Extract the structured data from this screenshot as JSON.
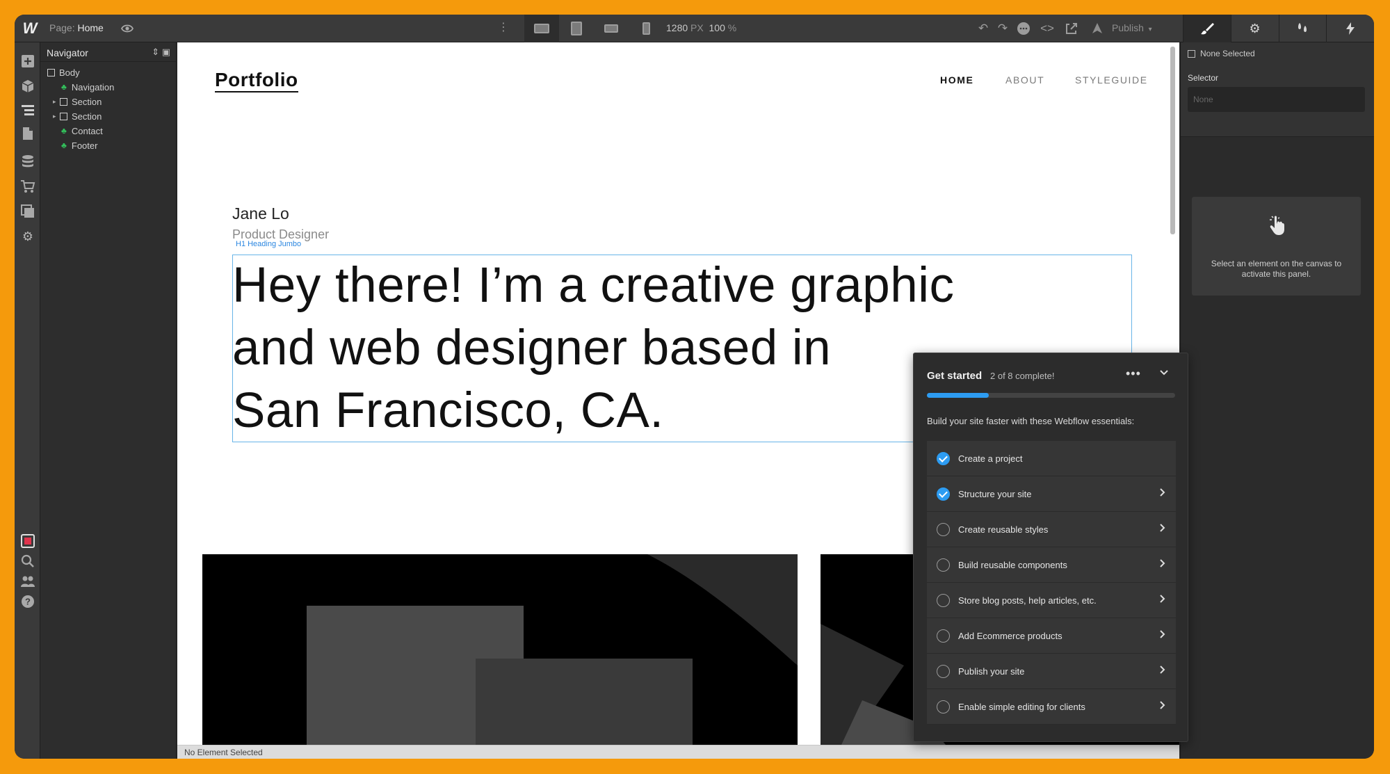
{
  "topbar": {
    "logo": "W",
    "page_key": "Page:",
    "page_value": "Home",
    "width_value": "1280",
    "width_unit": "PX",
    "zoom_value": "100",
    "zoom_unit": "%",
    "publish_label": "Publish",
    "icons": [
      "eye-icon",
      "more-vertical-icon",
      "desktop-icon",
      "tablet-icon",
      "mobile-landscape-icon",
      "mobile-portrait-icon",
      "undo-icon",
      "redo-icon",
      "comments-icon",
      "code-icon",
      "export-icon",
      "publish-icon"
    ],
    "right_tabs": [
      "style-brush-icon",
      "settings-gear-icon",
      "interactions-icon",
      "lightning-icon"
    ]
  },
  "rail_icons": [
    "add-icon",
    "components-icon",
    "navigator-icon",
    "pages-icon",
    "cms-icon",
    "ecommerce-icon",
    "assets-icon",
    "settings-icon",
    "audit-icon",
    "search-icon",
    "team-icon",
    "help-icon"
  ],
  "navigator": {
    "title": "Navigator",
    "items": [
      {
        "label": "Body",
        "kind": "box"
      },
      {
        "label": "Navigation",
        "kind": "symbol"
      },
      {
        "label": "Section",
        "kind": "box"
      },
      {
        "label": "Section",
        "kind": "box"
      },
      {
        "label": "Contact",
        "kind": "symbol"
      },
      {
        "label": "Footer",
        "kind": "symbol"
      }
    ]
  },
  "site": {
    "logo": "Portfolio",
    "nav": [
      "HOME",
      "ABOUT",
      "STYLEGUIDE"
    ],
    "name": "Jane Lo",
    "role": "Product Designer",
    "tag": "H1 Heading Jumbo",
    "heading_lines": [
      "Hey there! I’m a creative graphic",
      "and web designer based in",
      "San Francisco, CA."
    ]
  },
  "status_bar": "No Element Selected",
  "right_panel": {
    "none_selected": "None Selected",
    "selector_label": "Selector",
    "selector_placeholder": "None",
    "hint": "Select an element on the canvas to activate this panel."
  },
  "get_started": {
    "title": "Get started",
    "count": "2 of 8 complete!",
    "progress": 0.25,
    "description": "Build your site faster with these Webflow essentials:",
    "items": [
      {
        "label": "Create a project",
        "done": true
      },
      {
        "label": "Structure your site",
        "done": true
      },
      {
        "label": "Create reusable styles",
        "done": false
      },
      {
        "label": "Build reusable components",
        "done": false
      },
      {
        "label": "Store blog posts, help articles, etc.",
        "done": false
      },
      {
        "label": "Add Ecommerce products",
        "done": false
      },
      {
        "label": "Publish your site",
        "done": false
      },
      {
        "label": "Enable simple editing for clients",
        "done": false
      }
    ]
  },
  "colors": {
    "background": "#f59a0c",
    "accent": "#2d9cf2",
    "symbol_green": "#33c35c",
    "selection": "#67b4e8"
  }
}
